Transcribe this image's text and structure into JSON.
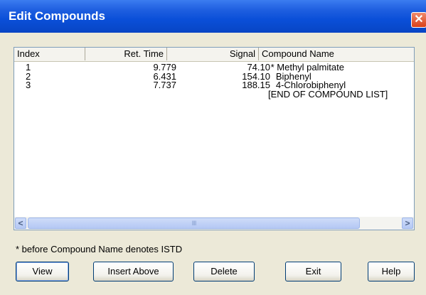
{
  "window": {
    "title": "Edit Compounds",
    "close_glyph": "✕"
  },
  "table": {
    "columns": [
      "Index",
      "Ret. Time",
      "Signal",
      "Compound Name"
    ],
    "rows": [
      {
        "index": "1",
        "ret_time": "9.779",
        "signal": "74.10",
        "name": " * Methyl palmitate"
      },
      {
        "index": "2",
        "ret_time": "6.431",
        "signal": "154.10",
        "name": "   Biphenyl"
      },
      {
        "index": "3",
        "ret_time": "7.737",
        "signal": "188.15",
        "name": "   4-Chlorobiphenyl"
      },
      {
        "index": "",
        "ret_time": "",
        "signal": "",
        "name": "[END OF COMPOUND LIST]"
      }
    ]
  },
  "scrollbar": {
    "left_glyph": "<",
    "right_glyph": ">",
    "thumb_grip": "IIII"
  },
  "footnote": "* before Compound Name denotes ISTD",
  "buttons": {
    "view": "View",
    "insert_above": "Insert Above",
    "delete": "Delete",
    "exit": "Exit",
    "help": "Help"
  }
}
